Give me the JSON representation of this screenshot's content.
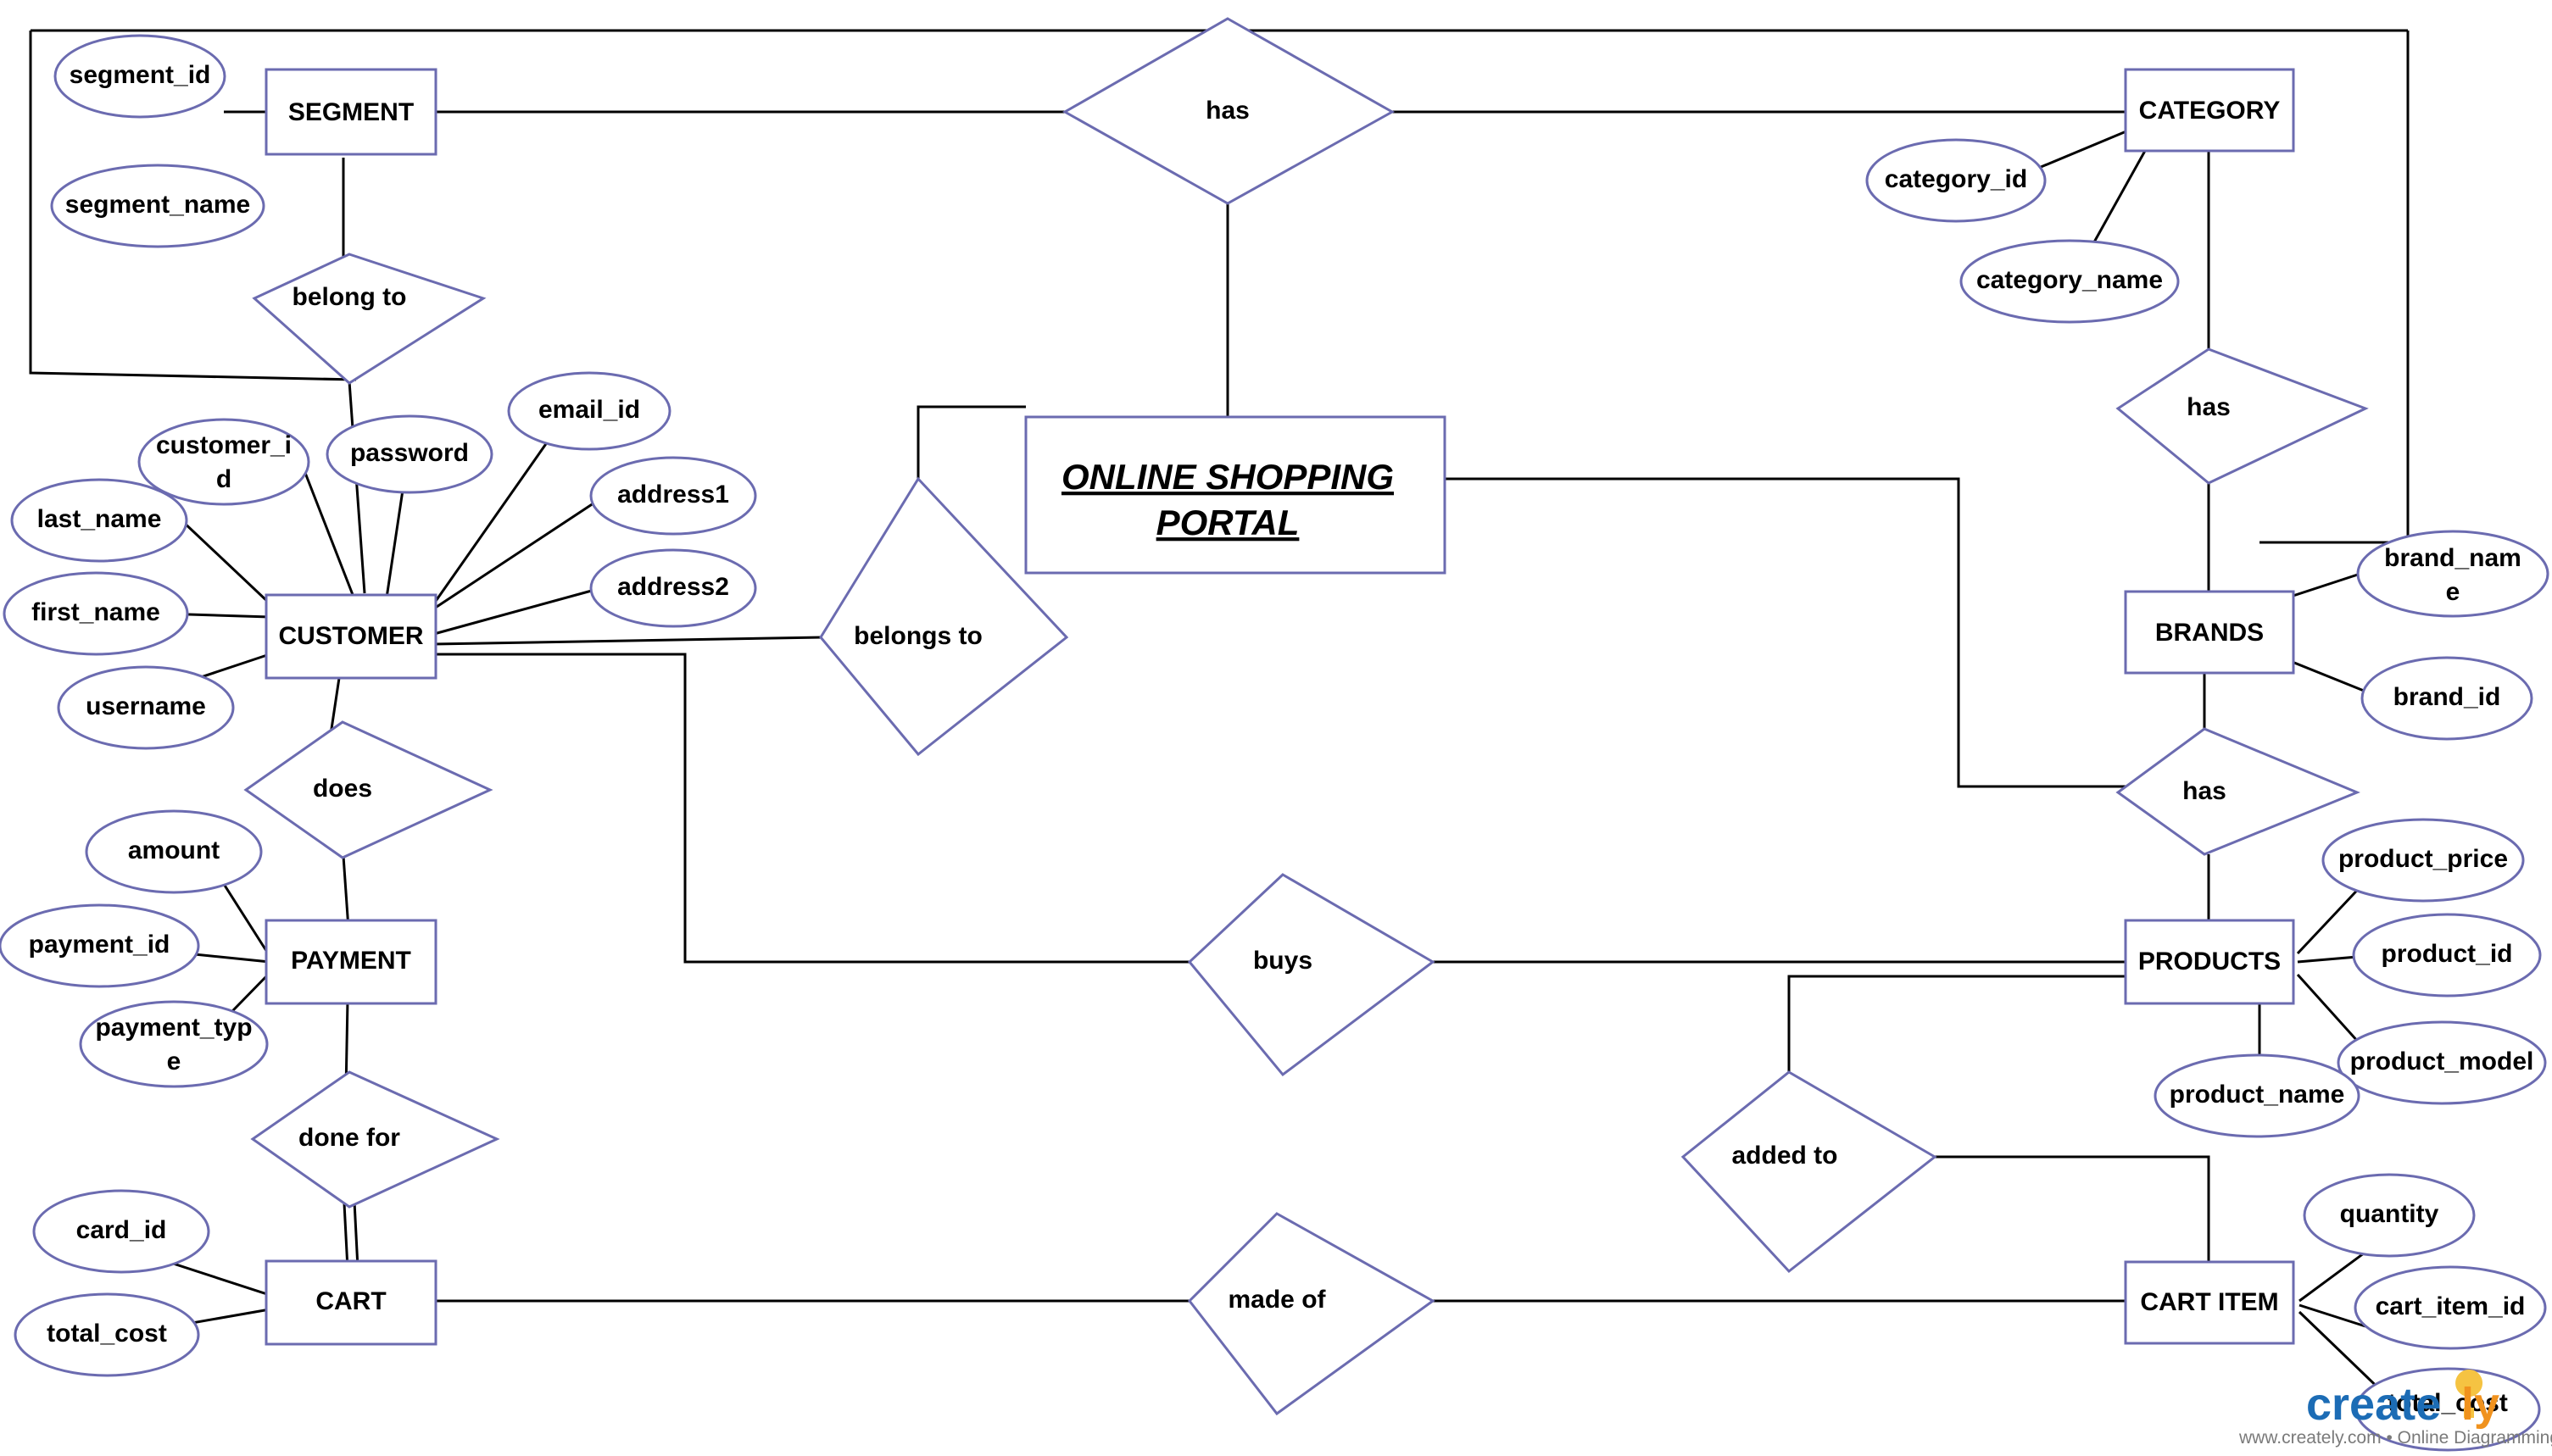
{
  "diagram": {
    "title": "ONLINE SHOPPING PORTAL",
    "title_line1": "ONLINE SHOPPING",
    "title_line2": "PORTAL",
    "colors": {
      "shape_border": "#6b6bb0",
      "connector": "#000000",
      "background": "#ffffff",
      "text": "#000000",
      "watermark_blue": "#1c6cb5",
      "watermark_orange": "#f0921e",
      "watermark_grey": "#7a7a7a"
    },
    "entities": [
      {
        "id": "segment",
        "label": "SEGMENT"
      },
      {
        "id": "customer",
        "label": "CUSTOMER"
      },
      {
        "id": "payment",
        "label": "PAYMENT"
      },
      {
        "id": "cart",
        "label": "CART"
      },
      {
        "id": "category",
        "label": "CATEGORY"
      },
      {
        "id": "brands",
        "label": "BRANDS"
      },
      {
        "id": "products",
        "label": "PRODUCTS"
      },
      {
        "id": "cart_item",
        "label": "CART ITEM"
      }
    ],
    "relationships": [
      {
        "id": "has_top",
        "label": "has"
      },
      {
        "id": "belong_to",
        "label": "belong to"
      },
      {
        "id": "belongs_to",
        "label": "belongs to"
      },
      {
        "id": "does",
        "label": "does"
      },
      {
        "id": "done_for",
        "label": "done for"
      },
      {
        "id": "buys",
        "label": "buys"
      },
      {
        "id": "made_of",
        "label": "made of"
      },
      {
        "id": "added_to",
        "label": "added to"
      },
      {
        "id": "has_category",
        "label": "has"
      },
      {
        "id": "has_brands",
        "label": "has"
      }
    ],
    "attributes": [
      {
        "id": "segment_id",
        "label": "segment_id",
        "entity": "segment"
      },
      {
        "id": "segment_name",
        "label": "segment_name",
        "entity": "segment"
      },
      {
        "id": "customer_id",
        "label": "customer_id",
        "entity": "customer",
        "line1": "customer_i",
        "line2": "d"
      },
      {
        "id": "password",
        "label": "password",
        "entity": "customer"
      },
      {
        "id": "email_id",
        "label": "email_id",
        "entity": "customer"
      },
      {
        "id": "address1",
        "label": "address1",
        "entity": "customer"
      },
      {
        "id": "address2",
        "label": "address2",
        "entity": "customer"
      },
      {
        "id": "last_name",
        "label": "last_name",
        "entity": "customer"
      },
      {
        "id": "first_name",
        "label": "first_name",
        "entity": "customer"
      },
      {
        "id": "username",
        "label": "username",
        "entity": "customer"
      },
      {
        "id": "amount",
        "label": "amount",
        "entity": "payment"
      },
      {
        "id": "payment_id",
        "label": "payment_id",
        "entity": "payment"
      },
      {
        "id": "payment_type",
        "label": "payment_type",
        "entity": "payment",
        "line1": "payment_typ",
        "line2": "e"
      },
      {
        "id": "card_id",
        "label": "card_id",
        "entity": "cart"
      },
      {
        "id": "cart_total_cost",
        "label": "total_cost",
        "entity": "cart"
      },
      {
        "id": "category_id",
        "label": "category_id",
        "entity": "category"
      },
      {
        "id": "category_name",
        "label": "category_name",
        "entity": "category"
      },
      {
        "id": "brand_name",
        "label": "brand_name",
        "entity": "brands",
        "line1": "brand_nam",
        "line2": "e"
      },
      {
        "id": "brand_id",
        "label": "brand_id",
        "entity": "brands"
      },
      {
        "id": "product_price",
        "label": "product_price",
        "entity": "products"
      },
      {
        "id": "product_id",
        "label": "product_id",
        "entity": "products"
      },
      {
        "id": "product_model",
        "label": "product_model",
        "entity": "products"
      },
      {
        "id": "product_name",
        "label": "product_name",
        "entity": "products"
      },
      {
        "id": "quantity",
        "label": "quantity",
        "entity": "cart_item"
      },
      {
        "id": "cart_item_id",
        "label": "cart_item_id",
        "entity": "cart_item"
      },
      {
        "id": "ci_total_cost",
        "label": "total_cost",
        "entity": "cart_item"
      }
    ],
    "watermark": {
      "brand_part1": "create",
      "brand_part2": "ly",
      "tagline": "www.creately.com • Online Diagramming"
    }
  }
}
